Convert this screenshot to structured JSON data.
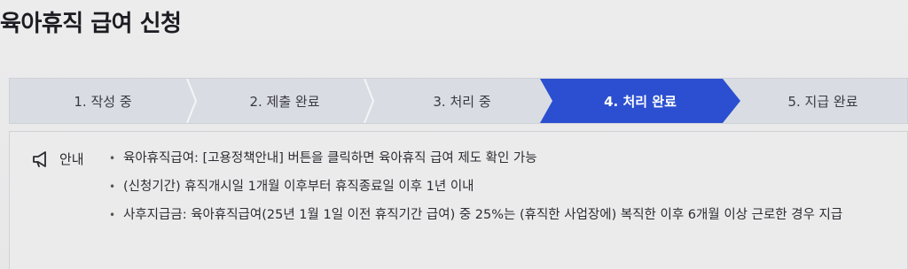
{
  "page": {
    "title": "육아휴직 급여 신청"
  },
  "stepper": {
    "steps": [
      {
        "label": "1. 작성 중"
      },
      {
        "label": "2. 제출 완료"
      },
      {
        "label": "3. 처리 중"
      },
      {
        "label": "4. 처리 완료",
        "active": true
      },
      {
        "label": "5. 지급 완료"
      }
    ],
    "active_color": "#2b4fd0"
  },
  "notice": {
    "icon": "megaphone-icon",
    "title": "안내",
    "items": [
      "육아휴직급여: [고용정책안내] 버튼을 클릭하면 육아휴직 급여 제도 확인 가능",
      "(신청기간) 휴직개시일 1개월 이후부터 휴직종료일 이후 1년 이내",
      "사후지급금: 육아휴직급여(25년 1월 1일 이전 휴직기간 급여) 중 25%는 (휴직한 사업장에) 복직한 이후 6개월 이상 근로한 경우 지급"
    ]
  }
}
